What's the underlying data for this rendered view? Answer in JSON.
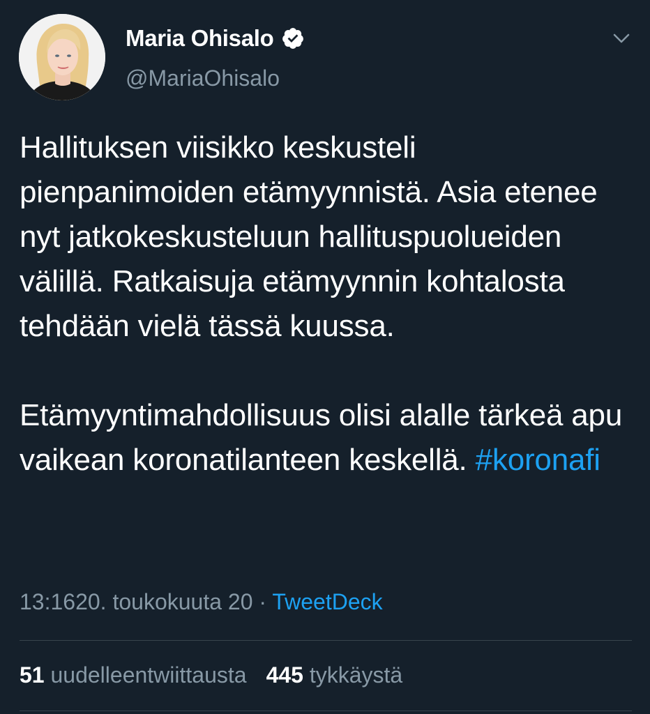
{
  "author": {
    "display_name": "Maria Ohisalo",
    "handle": "@MariaOhisalo",
    "verified": true,
    "avatar_icon": "profile-photo"
  },
  "tweet": {
    "paragraph_1": "Hallituksen viisikko keskusteli pienpanimoiden etämyynnistä. Asia etenee nyt jatkokeskusteluun hallituspuolueiden välillä. Ratkaisuja etämyynnin kohtalosta tehdään vielä tässä kuussa.",
    "paragraph_2": "Etämyyntimahdollisuus olisi alalle tärkeä apu vaikean koronatilanteen keskellä.",
    "hashtag": "#koronafi"
  },
  "meta": {
    "time": "13:16",
    "date": "20. toukokuuta 20",
    "separator": "·",
    "source": "TweetDeck"
  },
  "stats": {
    "retweets_count": "51",
    "retweets_label": "uudelleentwiittausta",
    "likes_count": "445",
    "likes_label": "tykkäystä"
  },
  "colors": {
    "background": "#15202b",
    "text": "#ffffff",
    "secondary": "#8899a6",
    "accent": "#1da1f2",
    "divider": "#38444d"
  },
  "icons": {
    "verified": "verified-badge-icon",
    "more": "chevron-down-icon"
  }
}
